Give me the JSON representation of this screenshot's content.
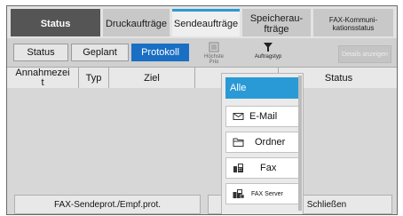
{
  "tabs": [
    {
      "label": "Status"
    },
    {
      "label": "Druckaufträge"
    },
    {
      "label": "Sendeaufträge"
    },
    {
      "label": "Speicherau-\nfträge"
    },
    {
      "label": "FAX-Kommuni-\nkationsstatus"
    }
  ],
  "subtabs": [
    {
      "label": "Status"
    },
    {
      "label": "Geplant"
    },
    {
      "label": "Protokoll"
    }
  ],
  "toolbar": {
    "priority_label": "Höchste Prio",
    "jobtype_label": "Auftragstyp",
    "details_label": "Details anzeigen"
  },
  "table": {
    "headers": [
      "Annahmezei\nt",
      "Typ",
      "Ziel",
      "",
      "Status"
    ]
  },
  "dropdown": {
    "items": [
      {
        "label": "Alle",
        "icon": "none"
      },
      {
        "label": "E-Mail",
        "icon": "email-icon"
      },
      {
        "label": "Ordner",
        "icon": "folder-icon"
      },
      {
        "label": "Fax",
        "icon": "fax-icon"
      },
      {
        "label": "FAX Server",
        "icon": "fax-server-icon"
      }
    ]
  },
  "bottom": {
    "left_label": "FAX-Sendeprot./Empf.prot.",
    "right_label": "Schließen"
  },
  "colors": {
    "accent": "#2a9ad6",
    "selected_subtab": "#1a6fc4",
    "active_tab": "#555555"
  }
}
